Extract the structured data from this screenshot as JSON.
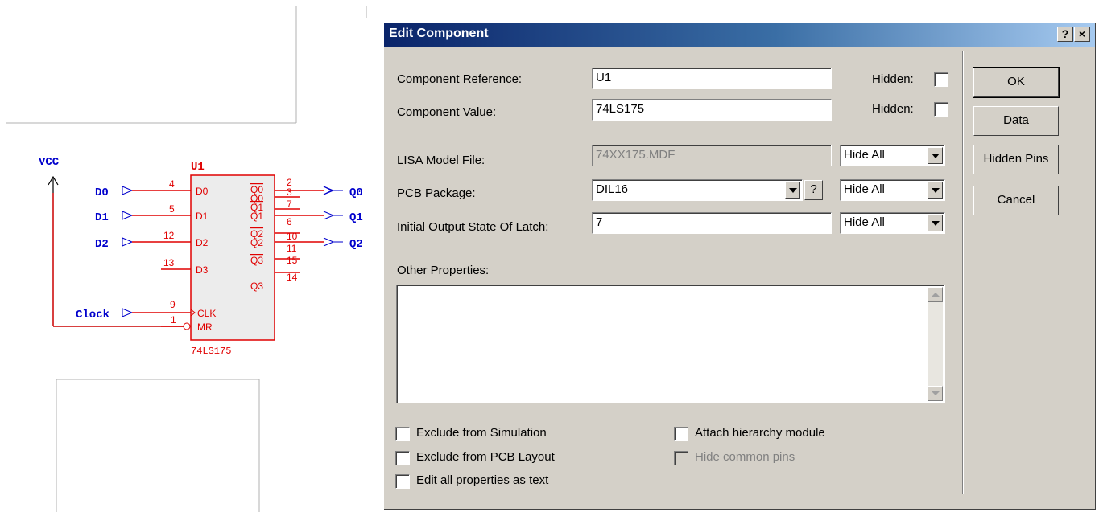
{
  "schematic": {
    "power_label": "VCC",
    "ref": "U1",
    "value": "74LS175",
    "inputs": [
      {
        "net": "D0",
        "pin_num": "4",
        "pin_name": "D0"
      },
      {
        "net": "D1",
        "pin_num": "5",
        "pin_name": "D1"
      },
      {
        "net": "D2",
        "pin_num": "12",
        "pin_name": "D2"
      },
      {
        "net": "",
        "pin_num": "13",
        "pin_name": "D3"
      }
    ],
    "clock": {
      "net": "Clock",
      "pin_num": "9",
      "pin_name": "CLK"
    },
    "reset": {
      "pin_num": "1",
      "pin_name": "MR"
    },
    "outputs": [
      {
        "pin_name": "Q0",
        "pin_num": "2"
      },
      {
        "pin_name": "Q0",
        "pin_num": "3"
      },
      {
        "pin_name": "Q1",
        "pin_num": "7"
      },
      {
        "pin_name": "Q1",
        "pin_num": "6"
      },
      {
        "pin_name": "Q2",
        "pin_num": "10"
      },
      {
        "pin_name": "Q2",
        "pin_num": "11"
      },
      {
        "pin_name": "Q3",
        "pin_num": "15"
      },
      {
        "pin_name": "Q3",
        "pin_num": "14"
      }
    ],
    "output_nets": [
      "Q0",
      "Q1",
      "Q2"
    ],
    "colors": {
      "component": "#e00000",
      "net_label": "#0000cc",
      "wire": "#cc0000"
    }
  },
  "dialog": {
    "title": "Edit Component",
    "help_btn": "?",
    "close_btn": "×",
    "fields": {
      "reference_label": "Component Reference:",
      "reference_value": "U1",
      "value_label": "Component Value:",
      "value_value": "74LS175",
      "hidden_label": "Hidden:",
      "lisa_label": "LISA Model File:",
      "lisa_value": "74XX175.MDF",
      "pcb_label": "PCB Package:",
      "pcb_value": "DIL16",
      "pcb_help": "?",
      "latch_label": "Initial Output State Of Latch:",
      "latch_value": "7",
      "hide_all": "Hide All",
      "other_label": "Other Properties:"
    },
    "checkboxes": {
      "exclude_sim": "Exclude from Simulation",
      "exclude_pcb": "Exclude from PCB Layout",
      "edit_text": "Edit all properties as text",
      "attach_module": "Attach hierarchy module",
      "hide_common": "Hide common pins"
    },
    "buttons": {
      "ok": "OK",
      "data": "Data",
      "hidden_pins": "Hidden Pins",
      "cancel": "Cancel"
    }
  }
}
